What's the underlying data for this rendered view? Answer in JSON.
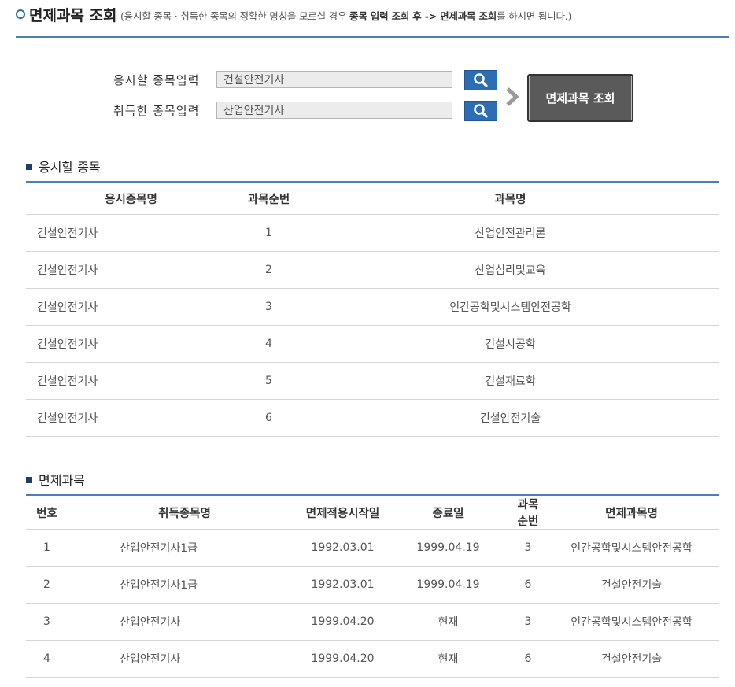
{
  "header": {
    "title": "면제과목 조회",
    "note_prefix": "(응시할 종목 · 취득한 종목의 정확한 명칭을 모르실 경우 ",
    "note_bold1": "종목 입력 조회 후 -> 면제과목 조회",
    "note_suffix": "를 하시면 됩니다.)"
  },
  "form": {
    "apply_label": "응시할 종목입력",
    "apply_value": "건설안전기사",
    "acquired_label": "취득한 종목입력",
    "acquired_value": "산업안전기사",
    "submit_label": "면제과목 조회",
    "search_icon": "search-icon",
    "arrow_icon": "chevron-right-icon"
  },
  "apply_section": {
    "title": "응시할 종목",
    "headers": [
      "응시종목명",
      "과목순번",
      "과목명"
    ],
    "rows": [
      [
        "건설안전기사",
        "1",
        "산업안전관리론"
      ],
      [
        "건설안전기사",
        "2",
        "산업심리및교육"
      ],
      [
        "건설안전기사",
        "3",
        "인간공학및시스템안전공학"
      ],
      [
        "건설안전기사",
        "4",
        "건설시공학"
      ],
      [
        "건설안전기사",
        "5",
        "건설재료학"
      ],
      [
        "건설안전기사",
        "6",
        "건설안전기술"
      ]
    ]
  },
  "exempt_section": {
    "title": "면제과목",
    "headers": [
      "번호",
      "취득종목명",
      "면제적용시작일",
      "종료일",
      "과목순번",
      "면제과목명"
    ],
    "rows": [
      [
        "1",
        "산업안전기사1급",
        "1992.03.01",
        "1999.04.19",
        "3",
        "인간공학및시스템안전공학"
      ],
      [
        "2",
        "산업안전기사1급",
        "1992.03.01",
        "1999.04.19",
        "6",
        "건설안전기술"
      ],
      [
        "3",
        "산업안전기사",
        "1999.04.20",
        "현재",
        "3",
        "인간공학및시스템안전공학"
      ],
      [
        "4",
        "산업안전기사",
        "1999.04.20",
        "현재",
        "6",
        "건설안전기술"
      ]
    ]
  },
  "colors": {
    "accent": "#2d6db4",
    "rule": "#4a7fb5",
    "button_dark": "#5a5a5a"
  }
}
